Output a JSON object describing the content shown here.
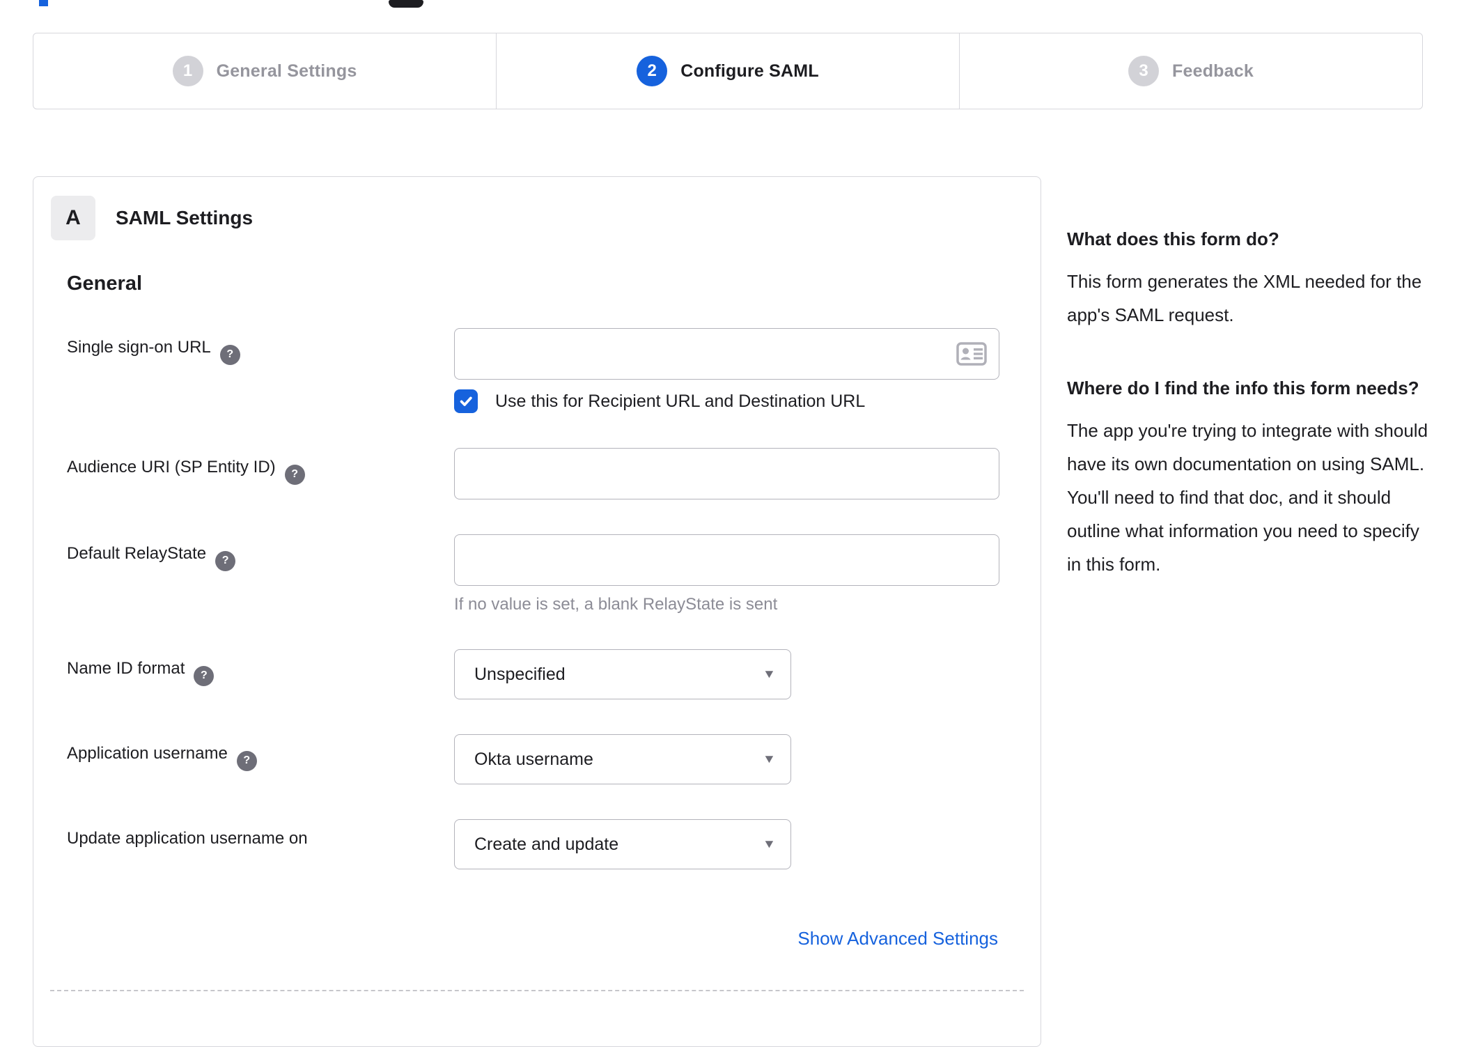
{
  "colors": {
    "accent_blue": "#1662dd",
    "panel_border": "#d7d7dc",
    "input_border": "#b3b3bb",
    "text_dark": "#1d1d21",
    "text_gray": "#8c8c96"
  },
  "icons": {
    "help_glyph": "?",
    "dropdown_arrow": "▼"
  },
  "stepper": {
    "steps": [
      {
        "number": "1",
        "label": "General Settings",
        "state": "inactive"
      },
      {
        "number": "2",
        "label": "Configure SAML",
        "state": "active"
      },
      {
        "number": "3",
        "label": "Feedback",
        "state": "inactive"
      }
    ]
  },
  "saml_panel": {
    "section_badge": "A",
    "section_title": "SAML Settings",
    "group_title": "General",
    "fields": {
      "sso_url": {
        "label": "Single sign-on URL",
        "value": "",
        "checkbox_label": "Use this for Recipient URL and Destination URL",
        "checked": true
      },
      "audience_uri": {
        "label": "Audience URI (SP Entity ID)",
        "value": ""
      },
      "default_relaystate": {
        "label": "Default RelayState",
        "value": "",
        "helper": "If no value is set, a blank RelayState is sent"
      },
      "name_id_format": {
        "label": "Name ID format",
        "value": "Unspecified"
      },
      "app_username": {
        "label": "Application username",
        "value": "Okta username"
      },
      "update_app_username": {
        "label": "Update application username on",
        "value": "Create and update"
      }
    },
    "advanced_link": "Show Advanced Settings"
  },
  "help_panel": {
    "q1_title": "What does this form do?",
    "q1_body": "This form generates the XML needed for the app's SAML request.",
    "q2_title": "Where do I find the info this form needs?",
    "q2_body": "The app you're trying to integrate with should have its own documentation on using SAML. You'll need to find that doc, and it should outline what information you need to specify in this form."
  }
}
